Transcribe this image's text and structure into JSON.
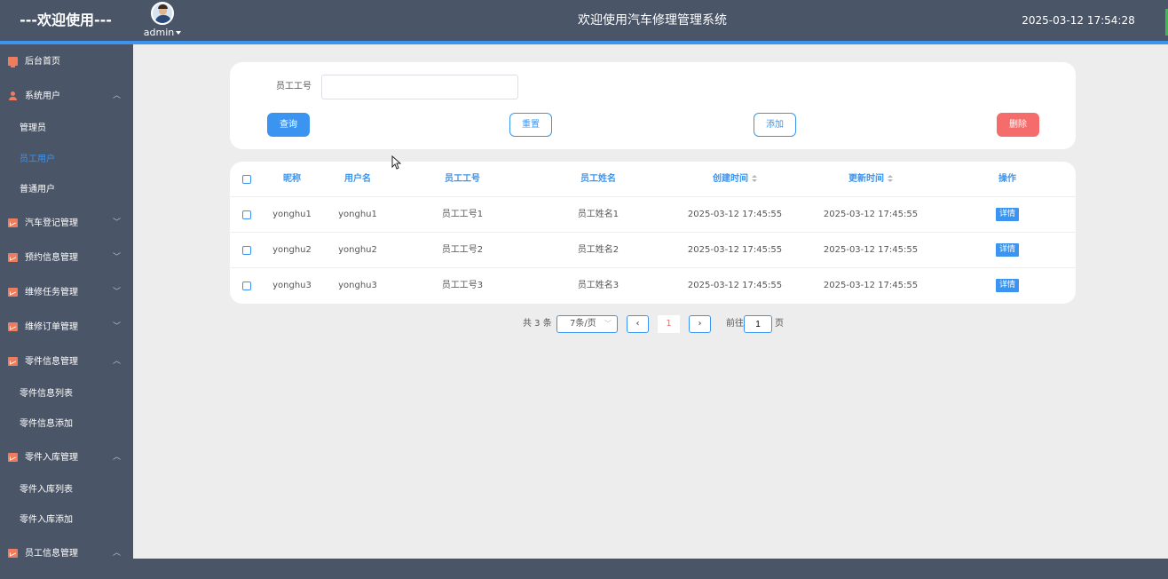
{
  "header": {
    "brand": "---欢迎使用---",
    "username": "admin",
    "title": "欢迎使用汽车修理管理系统",
    "datetime": "2025-03-12 17:54:28"
  },
  "sidebar": {
    "items": [
      {
        "label": "后台首页",
        "icon": "monitor-icon"
      },
      {
        "label": "系统用户",
        "icon": "user-icon",
        "arrow": "^",
        "children": [
          {
            "label": "管理员"
          },
          {
            "label": "员工用户",
            "active": true
          },
          {
            "label": "普通用户"
          }
        ]
      },
      {
        "label": "汽车登记管理",
        "icon": "chart-icon",
        "arrow": "v"
      },
      {
        "label": "预约信息管理",
        "icon": "chart-icon",
        "arrow": "v"
      },
      {
        "label": "维修任务管理",
        "icon": "chart-icon",
        "arrow": "v"
      },
      {
        "label": "维修订单管理",
        "icon": "chart-icon",
        "arrow": "v"
      },
      {
        "label": "零件信息管理",
        "icon": "chart-icon",
        "arrow": "^",
        "children": [
          {
            "label": "零件信息列表"
          },
          {
            "label": "零件信息添加"
          }
        ]
      },
      {
        "label": "零件入库管理",
        "icon": "chart-icon",
        "arrow": "^",
        "children": [
          {
            "label": "零件入库列表"
          },
          {
            "label": "零件入库添加"
          }
        ]
      },
      {
        "label": "员工信息管理",
        "icon": "chart-icon",
        "arrow": "^"
      }
    ]
  },
  "search": {
    "field_label": "员工工号",
    "field_value": "",
    "field_placeholder": "",
    "query_label": "查询",
    "reset_label": "重置",
    "add_label": "添加",
    "delete_label": "删除"
  },
  "table": {
    "columns": {
      "nick": "昵称",
      "user": "用户名",
      "no": "员工工号",
      "name": "员工姓名",
      "created": "创建时间",
      "updated": "更新时间",
      "op": "操作"
    },
    "rows": [
      {
        "nick": "yonghu1",
        "user": "yonghu1",
        "no": "员工工号1",
        "name": "员工姓名1",
        "created": "2025-03-12 17:45:55",
        "updated": "2025-03-12 17:45:55",
        "op": "详情"
      },
      {
        "nick": "yonghu2",
        "user": "yonghu2",
        "no": "员工工号2",
        "name": "员工姓名2",
        "created": "2025-03-12 17:45:55",
        "updated": "2025-03-12 17:45:55",
        "op": "详情"
      },
      {
        "nick": "yonghu3",
        "user": "yonghu3",
        "no": "员工工号3",
        "name": "员工姓名3",
        "created": "2025-03-12 17:45:55",
        "updated": "2025-03-12 17:45:55",
        "op": "详情"
      }
    ]
  },
  "pagination": {
    "total_text": "共 3 条",
    "page_size": "7条/页",
    "current_page": "1",
    "goto_label": "前往",
    "goto_value": "1",
    "page_suffix": "页"
  },
  "colors": {
    "header_bg": "#4a5568",
    "accent": "#3b95f0",
    "danger": "#f56c6c",
    "icon": "#ee7d60"
  }
}
